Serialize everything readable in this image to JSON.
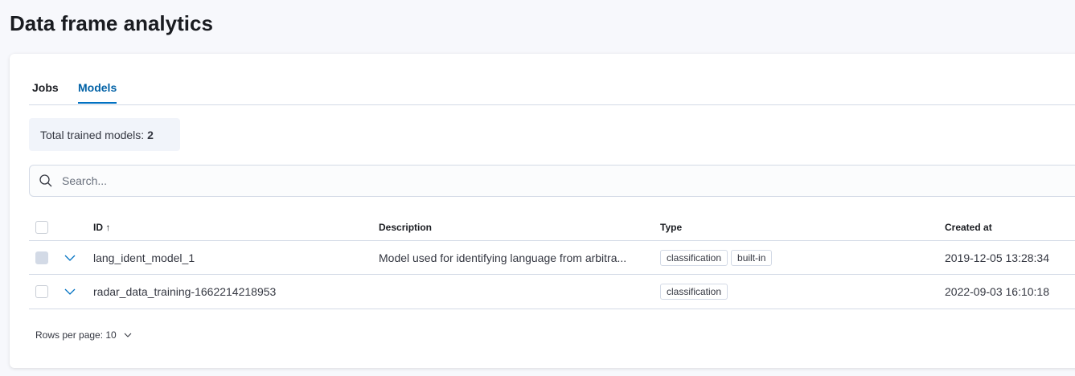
{
  "page_title": "Data frame analytics",
  "tabs": [
    {
      "label": "Jobs"
    },
    {
      "label": "Models"
    }
  ],
  "stats": {
    "label": "Total trained models:",
    "value": "2"
  },
  "search": {
    "placeholder": "Search..."
  },
  "table": {
    "headers": {
      "id": "ID",
      "description": "Description",
      "type": "Type",
      "created": "Created at"
    },
    "rows": [
      {
        "id": "lang_ident_model_1",
        "description": "Model used for identifying language from arbitra...",
        "types": [
          "classification",
          "built-in"
        ],
        "created": "2019-12-05 13:28:34"
      },
      {
        "id": "radar_data_training-1662214218953",
        "description": "",
        "types": [
          "classification"
        ],
        "created": "2022-09-03 16:10:18"
      }
    ]
  },
  "pagination": {
    "rows_per_page": "Rows per page: 10"
  }
}
